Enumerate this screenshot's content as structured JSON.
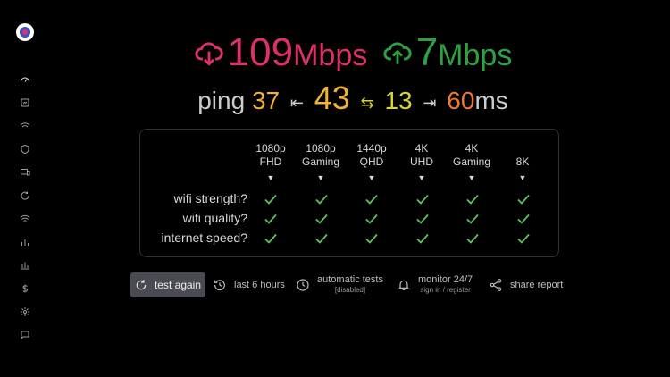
{
  "speed": {
    "download_value": "109",
    "download_unit": "Mbps",
    "upload_value": "7",
    "upload_unit": "Mbps"
  },
  "ping": {
    "label": "ping",
    "min": "37",
    "avg": "43",
    "jitter": "13",
    "max": "60",
    "unit": "ms"
  },
  "columns": [
    {
      "line1": "1080p",
      "line2": "FHD"
    },
    {
      "line1": "1080p",
      "line2": "Gaming"
    },
    {
      "line1": "1440p",
      "line2": "QHD"
    },
    {
      "line1": "4K",
      "line2": "UHD"
    },
    {
      "line1": "4K",
      "line2": "Gaming"
    },
    {
      "line1": "8K",
      "line2": ""
    }
  ],
  "rows": [
    {
      "label": "wifi strength?"
    },
    {
      "label": "wifi quality?"
    },
    {
      "label": "internet speed?"
    }
  ],
  "actions": {
    "test_again": "test again",
    "last_hours": "last 6 hours",
    "automatic_tests": "automatic tests",
    "automatic_sub": "[disabled]",
    "monitor": "monitor 24/7",
    "monitor_sub": "sign in / register",
    "share": "share report"
  },
  "colors": {
    "download": "#e0306a",
    "upload": "#2ea043",
    "check": "#5cc45c",
    "ping_low": "#f2b233",
    "ping_high": "#f0782d"
  },
  "sidebar_icons": [
    "speed-gauge-icon",
    "history-icon",
    "wifi-signal-icon",
    "shield-icon",
    "devices-icon",
    "refresh-icon",
    "wifi-icon",
    "bar-chart-icon",
    "stacked-chart-icon",
    "dollar-icon",
    "gear-icon",
    "chat-icon"
  ]
}
